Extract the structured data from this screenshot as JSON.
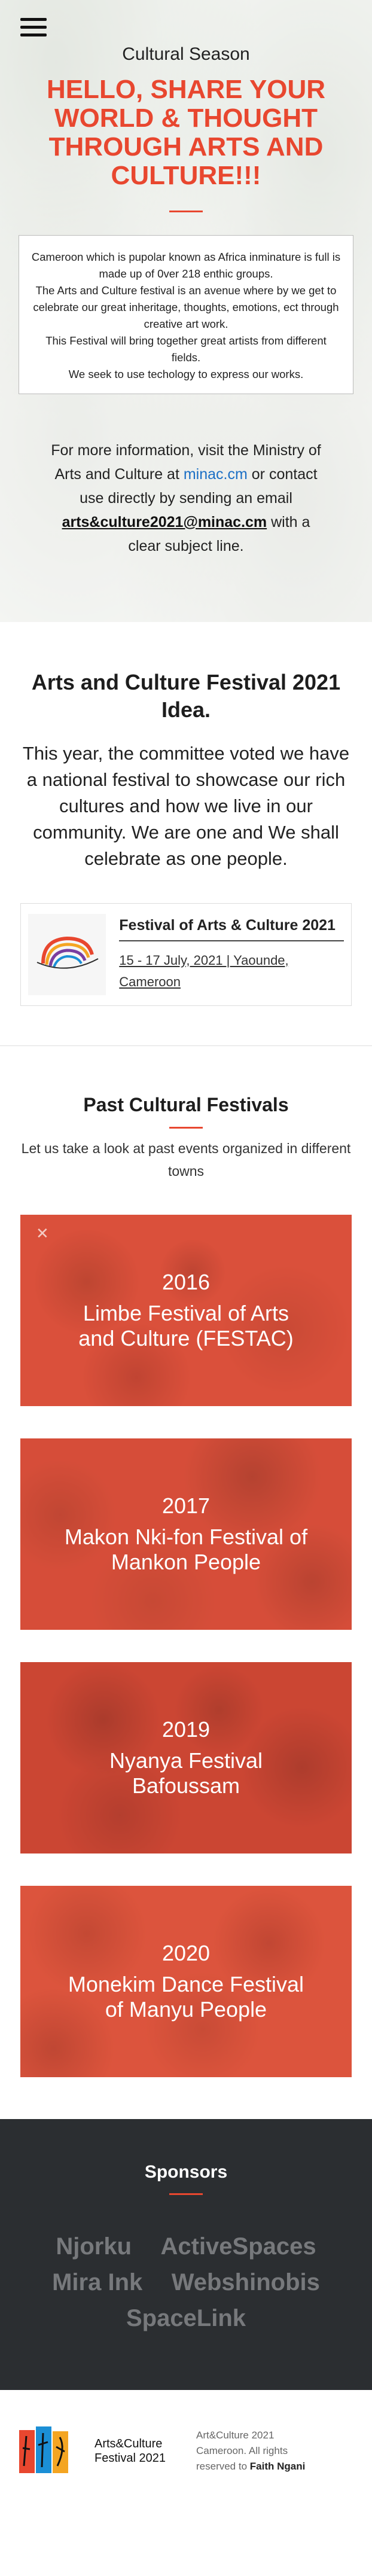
{
  "hero": {
    "menu_icon": "hamburger-menu-icon",
    "subtitle": "Cultural Season",
    "title": "HELLO, SHARE YOUR WORLD & THOUGHT THROUGH ARTS AND CULTURE!!!",
    "intro_lines": [
      "Cameroon which is pupolar known as Africa inminature is full is made up of 0ver 218 enthic groups.",
      "The Arts and Culture festival is an avenue where by we get to celebrate our great inheritage, thoughts, emotions, ect through creative art work.",
      "This Festival will bring together great artists from different fields.",
      "We seek to use techology to express our works."
    ],
    "contact": {
      "before_link": "For more information, visit the Ministry of Arts and Culture at",
      "link": "minac.cm",
      "after_link": "or contact use directly by sending an email",
      "email": "arts&culture2021@minac.cm",
      "tail": "with a clear subject line."
    }
  },
  "idea": {
    "heading": "Arts and Culture Festival 2021 Idea.",
    "lead": "This year, the committee voted we have a national festival to showcase our rich cultures and how we live in our community. We are one and We shall celebrate as one people.",
    "card": {
      "title": "Festival of Arts & Culture 2021",
      "meta": "15 - 17 July, 2021 | Yaounde, Cameroon"
    }
  },
  "past": {
    "heading": "Past Cultural Festivals",
    "sub": "Let us take a look at past events organized in different towns",
    "festivals": [
      {
        "year": "2016",
        "name": "Limbe Festival of Arts and Culture (FESTAC)"
      },
      {
        "year": "2017",
        "name": "Makon Nki-fon Festival of Mankon People"
      },
      {
        "year": "2019",
        "name": "Nyanya Festival Bafoussam"
      },
      {
        "year": "2020",
        "name": "Monekim Dance Festival of Manyu People"
      }
    ]
  },
  "sponsors": {
    "heading": "Sponsors",
    "items": [
      "Njorku",
      "ActiveSpaces",
      "Mira Ink",
      "Webshinobis",
      "SpaceLink"
    ]
  },
  "footer": {
    "brand_line1": "Arts&Culture",
    "brand_line2": "Festival 2021",
    "copy": "Art&Culture 2021 Cameroon. All rights reserved to",
    "author": "Faith Ngani"
  },
  "colors": {
    "accent": "#e8472f",
    "link": "#1b6fc5",
    "sponsor_bg": "#2b2e31"
  }
}
